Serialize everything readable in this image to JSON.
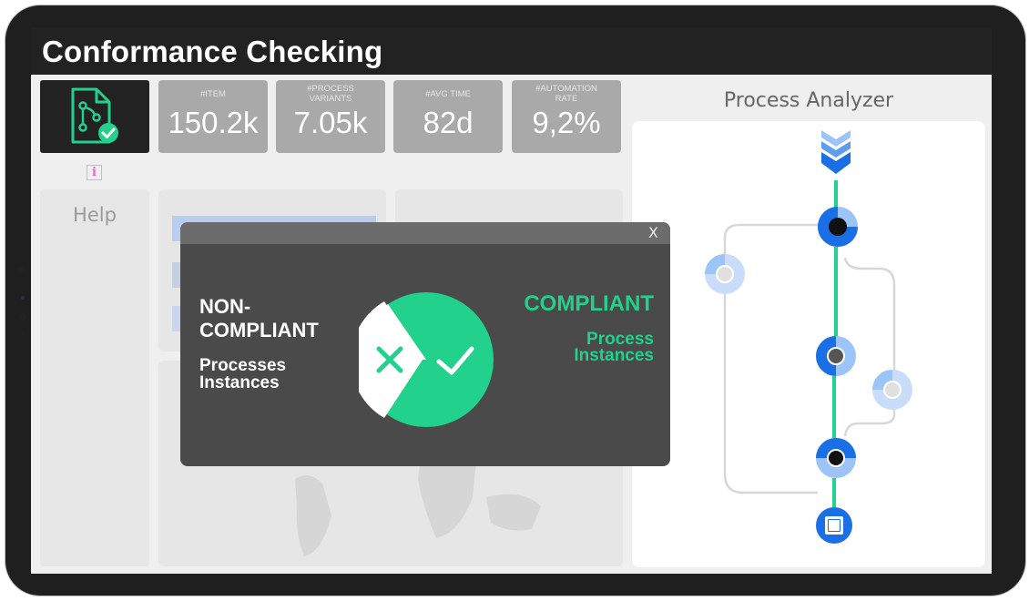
{
  "header": {
    "title": "Conformance Checking"
  },
  "kpis": [
    {
      "label": "#ITEM",
      "value": "150.2k"
    },
    {
      "label": "#PROCESS VARIANTS",
      "value": "7.05k"
    },
    {
      "label": "#AVG TIME",
      "value": "82d"
    },
    {
      "label": "#AUTOMATION RATE",
      "value": "9,2%"
    }
  ],
  "help": {
    "label": "Help"
  },
  "info": {
    "glyph": "i"
  },
  "analyzer": {
    "title": "Process Analyzer"
  },
  "modal": {
    "close_label": "X",
    "noncompliant_title_line1": "NON-",
    "noncompliant_title_line2": "COMPLIANT",
    "noncompliant_sub_line1": "Processes",
    "noncompliant_sub_line2": "Instances",
    "compliant_title": "COMPLIANT",
    "compliant_sub_line1": "Process",
    "compliant_sub_line2": "Instances"
  },
  "colors": {
    "accent_green": "#22d18b",
    "node_blue": "#1a6ee6",
    "node_light_blue": "#9cc4f7",
    "kpi_gray": "#a9a9a9",
    "dark": "#222222"
  },
  "icons": [
    "document-flow-check-icon",
    "info-icon",
    "close-icon",
    "x-mark-icon",
    "check-mark-icon",
    "double-chevron-down-icon",
    "stop-square-icon"
  ]
}
